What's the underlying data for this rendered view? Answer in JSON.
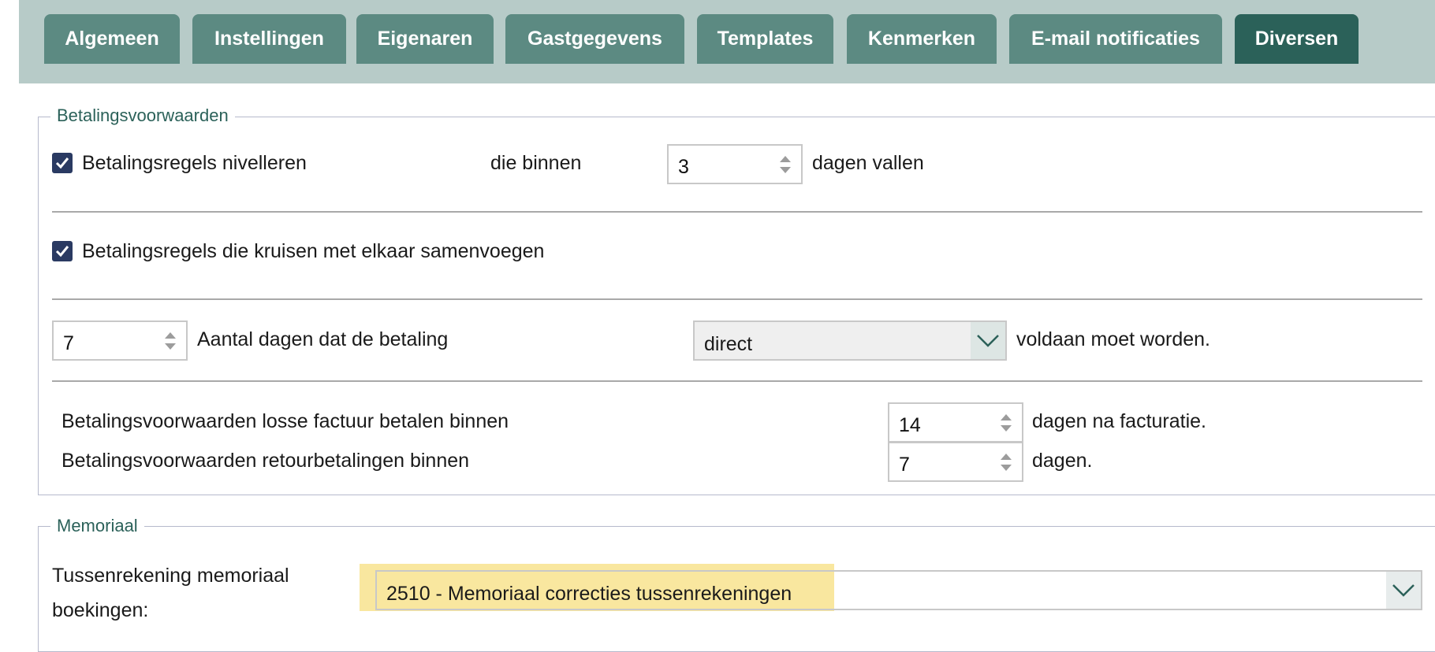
{
  "tabs": [
    {
      "label": "Algemeen",
      "active": false
    },
    {
      "label": "Instellingen",
      "active": false
    },
    {
      "label": "Eigenaren",
      "active": false
    },
    {
      "label": "Gastgegevens",
      "active": false
    },
    {
      "label": "Templates",
      "active": false
    },
    {
      "label": "Kenmerken",
      "active": false
    },
    {
      "label": "E-mail notificaties",
      "active": false
    },
    {
      "label": "Diversen",
      "active": true
    }
  ],
  "betaling": {
    "legend": "Betalingsvoorwaarden",
    "nivelleren": {
      "label": "Betalingsregels nivelleren",
      "checked": true,
      "within_label": "die binnen",
      "days_value": "3",
      "suffix": "dagen vallen"
    },
    "samenvoegen": {
      "label": "Betalingsregels die kruisen met elkaar samenvoegen",
      "checked": true
    },
    "aantal_dagen": {
      "value": "7",
      "label": "Aantal dagen dat de betaling",
      "select_value": "direct",
      "suffix": "voldaan moet worden."
    },
    "losse_factuur": {
      "label": "Betalingsvoorwaarden losse factuur betalen binnen",
      "value": "14",
      "suffix": "dagen na facturatie."
    },
    "retour": {
      "label": "Betalingsvoorwaarden retourbetalingen binnen",
      "value": "7",
      "suffix": "dagen."
    }
  },
  "memoriaal": {
    "legend": "Memoriaal",
    "tussenrekening_label_line1": "Tussenrekening memoriaal",
    "tussenrekening_label_line2": "boekingen:",
    "tussenrekening_value": "2510 - Memoriaal correcties tussenrekeningen"
  },
  "colors": {
    "tab_bg": "#5c8a82",
    "tab_active_bg": "#2b6159",
    "tabbar_bg": "#b7cbc8",
    "legend": "#2b6159",
    "checkbox": "#2a3a62",
    "highlight": "#f9e79f"
  },
  "icons": {
    "checkbox": "checkmark-icon",
    "spinner": "spinner-arrows-icon",
    "dropdown": "chevron-down-icon"
  }
}
